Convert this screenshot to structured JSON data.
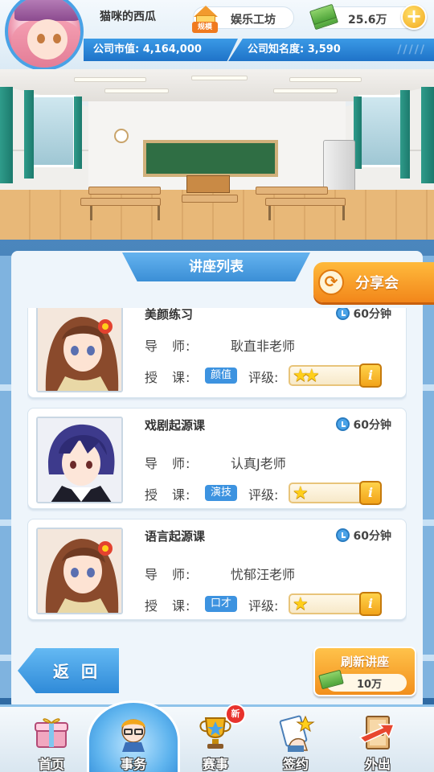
{
  "header": {
    "player_name": "猫咪的西瓜",
    "studio_badge": "规模",
    "studio_name": "娱乐工坊",
    "money": "25.6万",
    "add_symbol": "+",
    "market_value_label": "公司市值: 4,164,000",
    "reputation_label": "公司知名度: 3,590"
  },
  "panel": {
    "title": "讲座列表",
    "share_label": "分享会",
    "share_icon": "refresh-cycle-icon"
  },
  "lectures": [
    {
      "title": "美颜练习",
      "duration": "60分钟",
      "teacher_label": "导　师:",
      "teacher": "耿直非老师",
      "skill_label": "授　课:",
      "skill": "颜值",
      "rating_label": "评级:",
      "stars": 2,
      "info": "i",
      "portrait": "brown-hair-girl-portrait"
    },
    {
      "title": "戏剧起源课",
      "duration": "60分钟",
      "teacher_label": "导　师:",
      "teacher": "认真J老师",
      "skill_label": "授　课:",
      "skill": "演技",
      "rating_label": "评级:",
      "stars": 1,
      "info": "i",
      "portrait": "purple-hair-boy-portrait"
    },
    {
      "title": "语言起源课",
      "duration": "60分钟",
      "teacher_label": "导　师:",
      "teacher": "忧郁汪老师",
      "skill_label": "授　课:",
      "skill": "口才",
      "rating_label": "评级:",
      "stars": 1,
      "info": "i",
      "portrait": "brown-hair-girl-portrait"
    }
  ],
  "footer": {
    "back_label": "返 回",
    "refresh_label": "刷新讲座",
    "refresh_cost": "10万"
  },
  "nav": [
    {
      "label": "首页",
      "icon": "home-gift-icon"
    },
    {
      "label": "事务",
      "icon": "business-avatar-icon",
      "active": true
    },
    {
      "label": "赛事",
      "icon": "trophy-icon",
      "badge": "新"
    },
    {
      "label": "签约",
      "icon": "contract-hand-icon"
    },
    {
      "label": "外出",
      "icon": "door-exit-icon"
    }
  ],
  "colors": {
    "accent_blue": "#3b8fd6",
    "accent_orange": "#f2861a",
    "star_yellow": "#ffcf1a",
    "skill_badge": "#3d93e0"
  }
}
